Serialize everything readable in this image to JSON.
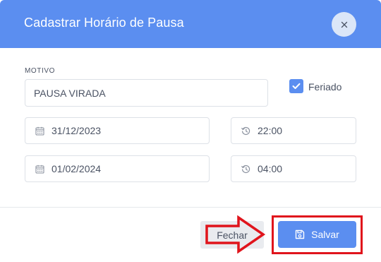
{
  "modal": {
    "title": "Cadastrar Horário de Pausa",
    "close_label": "×"
  },
  "form": {
    "motivo_label": "MOTIVO",
    "motivo_value": "PAUSA VIRADA",
    "feriado_label": "Feriado",
    "feriado_checked": true,
    "start_date": "31/12/2023",
    "start_time": "22:00",
    "end_date": "01/02/2024",
    "end_time": "04:00"
  },
  "footer": {
    "fechar_label": "Fechar",
    "salvar_label": "Salvar"
  },
  "icons": {
    "close": "close-icon",
    "date": "calendar-icon",
    "time": "clock-history-icon",
    "check": "check-icon",
    "save": "floppy-disk-icon"
  },
  "colors": {
    "header": "#5b8ef0",
    "primary_button": "#5b8ef0",
    "annotation_red": "#e0141c"
  }
}
